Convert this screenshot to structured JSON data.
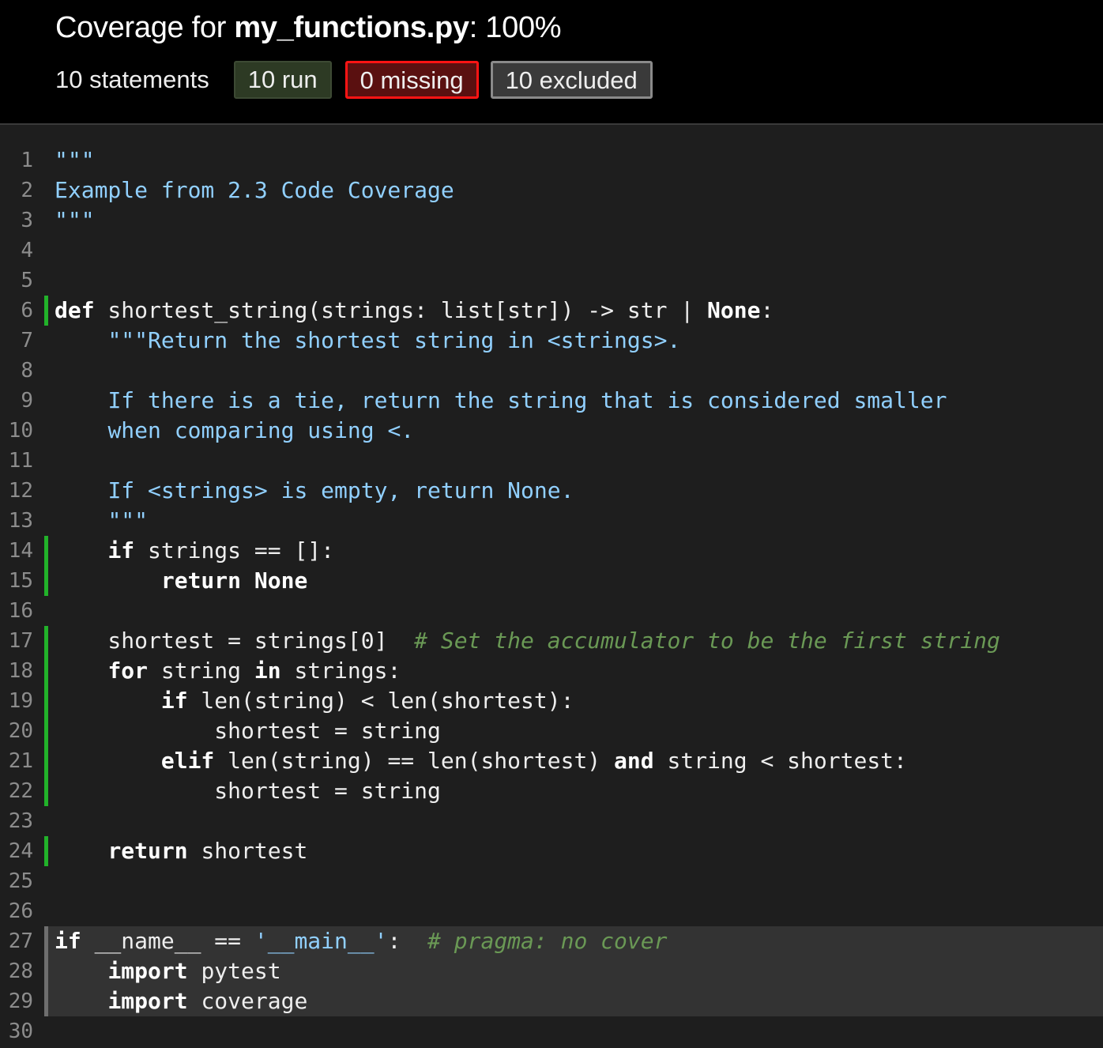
{
  "header": {
    "title_prefix": "Coverage for ",
    "file_name": "my_functions.py",
    "title_suffix": ": 100%",
    "statements": "10 statements",
    "run_label": "10 run",
    "missing_label": "0 missing",
    "excluded_label": "10 excluded"
  },
  "colors": {
    "header_bg": "#000000",
    "page_bg": "#1e1e1e",
    "run_marker": "#22b22a",
    "excluded_marker": "#6e6e6e",
    "missing_border": "#ff1414",
    "docstring": "#91d0ff",
    "comment": "#6a9955"
  },
  "source": {
    "lines": [
      {
        "n": "1",
        "status": "none",
        "tokens": [
          {
            "t": "s",
            "v": "\"\"\""
          }
        ]
      },
      {
        "n": "2",
        "status": "none",
        "tokens": [
          {
            "t": "s",
            "v": "Example from 2.3 Code Coverage"
          }
        ]
      },
      {
        "n": "3",
        "status": "none",
        "tokens": [
          {
            "t": "s",
            "v": "\"\"\""
          }
        ]
      },
      {
        "n": "4",
        "status": "none",
        "tokens": []
      },
      {
        "n": "5",
        "status": "none",
        "tokens": []
      },
      {
        "n": "6",
        "status": "run",
        "tokens": [
          {
            "t": "k",
            "v": "def"
          },
          {
            "t": "p",
            "v": " shortest_string(strings: list[str]) -> str | "
          },
          {
            "t": "k",
            "v": "None"
          },
          {
            "t": "p",
            "v": ":"
          }
        ]
      },
      {
        "n": "7",
        "status": "none",
        "tokens": [
          {
            "t": "p",
            "v": "    "
          },
          {
            "t": "s",
            "v": "\"\"\"Return the shortest string in <strings>."
          }
        ]
      },
      {
        "n": "8",
        "status": "none",
        "tokens": []
      },
      {
        "n": "9",
        "status": "none",
        "tokens": [
          {
            "t": "p",
            "v": "    "
          },
          {
            "t": "s",
            "v": "If there is a tie, return the string that is considered smaller"
          }
        ]
      },
      {
        "n": "10",
        "status": "none",
        "tokens": [
          {
            "t": "p",
            "v": "    "
          },
          {
            "t": "s",
            "v": "when comparing using <."
          }
        ]
      },
      {
        "n": "11",
        "status": "none",
        "tokens": []
      },
      {
        "n": "12",
        "status": "none",
        "tokens": [
          {
            "t": "p",
            "v": "    "
          },
          {
            "t": "s",
            "v": "If <strings> is empty, return None."
          }
        ]
      },
      {
        "n": "13",
        "status": "none",
        "tokens": [
          {
            "t": "p",
            "v": "    "
          },
          {
            "t": "s",
            "v": "\"\"\""
          }
        ]
      },
      {
        "n": "14",
        "status": "run",
        "tokens": [
          {
            "t": "p",
            "v": "    "
          },
          {
            "t": "k",
            "v": "if"
          },
          {
            "t": "p",
            "v": " strings == []:"
          }
        ]
      },
      {
        "n": "15",
        "status": "run",
        "tokens": [
          {
            "t": "p",
            "v": "        "
          },
          {
            "t": "k",
            "v": "return"
          },
          {
            "t": "p",
            "v": " "
          },
          {
            "t": "k",
            "v": "None"
          }
        ]
      },
      {
        "n": "16",
        "status": "none",
        "tokens": []
      },
      {
        "n": "17",
        "status": "run",
        "tokens": [
          {
            "t": "p",
            "v": "    shortest = strings[0]  "
          },
          {
            "t": "c",
            "v": "# Set the accumulator to be the first string"
          }
        ]
      },
      {
        "n": "18",
        "status": "run",
        "tokens": [
          {
            "t": "p",
            "v": "    "
          },
          {
            "t": "k",
            "v": "for"
          },
          {
            "t": "p",
            "v": " string "
          },
          {
            "t": "k",
            "v": "in"
          },
          {
            "t": "p",
            "v": " strings:"
          }
        ]
      },
      {
        "n": "19",
        "status": "run",
        "tokens": [
          {
            "t": "p",
            "v": "        "
          },
          {
            "t": "k",
            "v": "if"
          },
          {
            "t": "p",
            "v": " len(string) < len(shortest):"
          }
        ]
      },
      {
        "n": "20",
        "status": "run",
        "tokens": [
          {
            "t": "p",
            "v": "            shortest = string"
          }
        ]
      },
      {
        "n": "21",
        "status": "run",
        "tokens": [
          {
            "t": "p",
            "v": "        "
          },
          {
            "t": "k",
            "v": "elif"
          },
          {
            "t": "p",
            "v": " len(string) == len(shortest) "
          },
          {
            "t": "k",
            "v": "and"
          },
          {
            "t": "p",
            "v": " string < shortest:"
          }
        ]
      },
      {
        "n": "22",
        "status": "run",
        "tokens": [
          {
            "t": "p",
            "v": "            shortest = string"
          }
        ]
      },
      {
        "n": "23",
        "status": "none",
        "tokens": []
      },
      {
        "n": "24",
        "status": "run",
        "tokens": [
          {
            "t": "p",
            "v": "    "
          },
          {
            "t": "k",
            "v": "return"
          },
          {
            "t": "p",
            "v": " shortest"
          }
        ]
      },
      {
        "n": "25",
        "status": "none",
        "tokens": []
      },
      {
        "n": "26",
        "status": "none",
        "tokens": []
      },
      {
        "n": "27",
        "status": "exc",
        "tokens": [
          {
            "t": "k",
            "v": "if"
          },
          {
            "t": "p",
            "v": " __name__ == "
          },
          {
            "t": "s",
            "v": "'__main__'"
          },
          {
            "t": "p",
            "v": ":  "
          },
          {
            "t": "c",
            "v": "# pragma: no cover"
          }
        ]
      },
      {
        "n": "28",
        "status": "exc",
        "tokens": [
          {
            "t": "p",
            "v": "    "
          },
          {
            "t": "k",
            "v": "import"
          },
          {
            "t": "p",
            "v": " pytest"
          }
        ]
      },
      {
        "n": "29",
        "status": "exc",
        "tokens": [
          {
            "t": "p",
            "v": "    "
          },
          {
            "t": "k",
            "v": "import"
          },
          {
            "t": "p",
            "v": " coverage"
          }
        ]
      },
      {
        "n": "30",
        "status": "none",
        "tokens": []
      }
    ]
  }
}
